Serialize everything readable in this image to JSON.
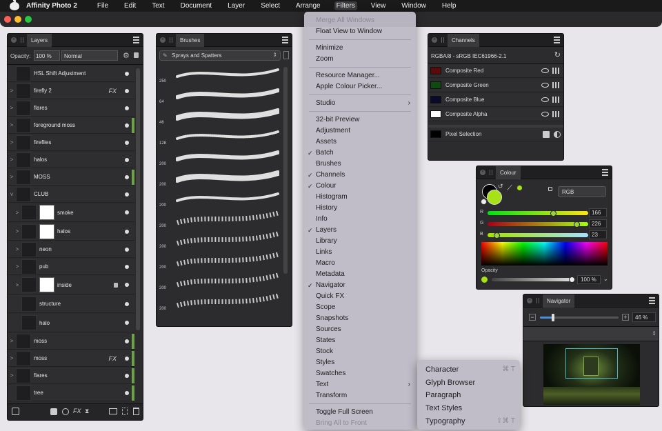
{
  "menubar": {
    "app": "Affinity Photo 2",
    "items": [
      "File",
      "Edit",
      "Text",
      "Document",
      "Layer",
      "Select",
      "Arrange",
      "Filters",
      "View",
      "Window",
      "Help"
    ],
    "open_index": 7
  },
  "layers": {
    "tab": "Layers",
    "opacity_label": "Opacity:",
    "opacity_value": "100 %",
    "blend_mode": "Normal",
    "rows": [
      {
        "name": "HSL Shift Adjustment",
        "exp": "",
        "tag": false,
        "fx": ""
      },
      {
        "name": "firefly 2",
        "exp": ">",
        "tag": false,
        "fx": "FX"
      },
      {
        "name": "flares",
        "exp": ">",
        "tag": false,
        "fx": ""
      },
      {
        "name": "foreground moss",
        "exp": ">",
        "tag": true,
        "fx": ""
      },
      {
        "name": "fireflies",
        "exp": ">",
        "tag": false,
        "fx": ""
      },
      {
        "name": "halos",
        "exp": ">",
        "tag": false,
        "fx": ""
      },
      {
        "name": "MOSS",
        "exp": ">",
        "tag": true,
        "fx": ""
      },
      {
        "name": "CLUB",
        "exp": "v",
        "tag": false,
        "fx": ""
      },
      {
        "name": "smoke",
        "exp": ">",
        "tag": false,
        "fx": ""
      },
      {
        "name": "halos",
        "exp": ">",
        "tag": false,
        "fx": ""
      },
      {
        "name": "neon",
        "exp": ">",
        "tag": false,
        "fx": ""
      },
      {
        "name": "pub",
        "exp": ">",
        "tag": false,
        "fx": ""
      },
      {
        "name": "inside",
        "exp": ">",
        "tag": false,
        "fx": ""
      },
      {
        "name": "structure",
        "exp": "",
        "tag": false,
        "fx": ""
      },
      {
        "name": "halo",
        "exp": "",
        "tag": false,
        "fx": ""
      },
      {
        "name": "moss",
        "exp": ">",
        "tag": true,
        "fx": ""
      },
      {
        "name": "moss",
        "exp": ">",
        "tag": true,
        "fx": "FX"
      },
      {
        "name": "flares",
        "exp": ">",
        "tag": true,
        "fx": ""
      },
      {
        "name": "tree",
        "exp": "",
        "tag": true,
        "fx": ""
      }
    ]
  },
  "brushes": {
    "tab": "Brushes",
    "category": "Sprays and Spatters",
    "sizes": [
      "250",
      "64",
      "46",
      "128",
      "200",
      "200",
      "200",
      "200",
      "200",
      "200",
      "200",
      "200"
    ]
  },
  "filters_menu": {
    "items": [
      {
        "label": "Merge All Windows",
        "disabled": true,
        "check": false,
        "sub": false
      },
      {
        "label": "Float View to Window",
        "disabled": false,
        "check": false,
        "sub": false
      },
      {
        "sep": true
      },
      {
        "label": "Minimize",
        "disabled": false,
        "check": false,
        "sub": false
      },
      {
        "label": "Zoom",
        "disabled": false,
        "check": false,
        "sub": false
      },
      {
        "sep": true
      },
      {
        "label": "Resource Manager...",
        "disabled": false,
        "check": false,
        "sub": false
      },
      {
        "label": "Apple Colour Picker...",
        "disabled": false,
        "check": false,
        "sub": false
      },
      {
        "sep": true
      },
      {
        "label": "Studio",
        "disabled": false,
        "check": false,
        "sub": true
      },
      {
        "sep": true
      },
      {
        "label": "32-bit Preview",
        "disabled": false,
        "check": false,
        "sub": false
      },
      {
        "label": "Adjustment",
        "disabled": false,
        "check": false,
        "sub": false
      },
      {
        "label": "Assets",
        "disabled": false,
        "check": false,
        "sub": false
      },
      {
        "label": "Batch",
        "disabled": false,
        "check": true,
        "sub": false
      },
      {
        "label": "Brushes",
        "disabled": false,
        "check": false,
        "sub": false
      },
      {
        "label": "Channels",
        "disabled": false,
        "check": true,
        "sub": false
      },
      {
        "label": "Colour",
        "disabled": false,
        "check": true,
        "sub": false
      },
      {
        "label": "Histogram",
        "disabled": false,
        "check": false,
        "sub": false
      },
      {
        "label": "History",
        "disabled": false,
        "check": false,
        "sub": false
      },
      {
        "label": "Info",
        "disabled": false,
        "check": false,
        "sub": false
      },
      {
        "label": "Layers",
        "disabled": false,
        "check": true,
        "sub": false
      },
      {
        "label": "Library",
        "disabled": false,
        "check": false,
        "sub": false
      },
      {
        "label": "Links",
        "disabled": false,
        "check": false,
        "sub": false
      },
      {
        "label": "Macro",
        "disabled": false,
        "check": false,
        "sub": false
      },
      {
        "label": "Metadata",
        "disabled": false,
        "check": false,
        "sub": false
      },
      {
        "label": "Navigator",
        "disabled": false,
        "check": true,
        "sub": false
      },
      {
        "label": "Quick FX",
        "disabled": false,
        "check": false,
        "sub": false
      },
      {
        "label": "Scope",
        "disabled": false,
        "check": false,
        "sub": false
      },
      {
        "label": "Snapshots",
        "disabled": false,
        "check": false,
        "sub": false
      },
      {
        "label": "Sources",
        "disabled": false,
        "check": false,
        "sub": false
      },
      {
        "label": "States",
        "disabled": false,
        "check": false,
        "sub": false
      },
      {
        "label": "Stock",
        "disabled": false,
        "check": false,
        "sub": false
      },
      {
        "label": "Styles",
        "disabled": false,
        "check": false,
        "sub": false
      },
      {
        "label": "Swatches",
        "disabled": false,
        "check": false,
        "sub": false
      },
      {
        "label": "Text",
        "disabled": false,
        "check": false,
        "sub": true
      },
      {
        "label": "Transform",
        "disabled": false,
        "check": false,
        "sub": false
      },
      {
        "sep": true
      },
      {
        "label": "Toggle Full Screen",
        "disabled": false,
        "check": false,
        "sub": false
      },
      {
        "label": "Bring All to Front",
        "disabled": true,
        "check": false,
        "sub": false
      }
    ]
  },
  "text_submenu": {
    "items": [
      {
        "label": "Character",
        "shortcut": "⌘ T"
      },
      {
        "label": "Glyph Browser",
        "shortcut": ""
      },
      {
        "label": "Paragraph",
        "shortcut": ""
      },
      {
        "label": "Text Styles",
        "shortcut": ""
      },
      {
        "label": "Typography",
        "shortcut": "⇧⌘ T"
      }
    ]
  },
  "channels": {
    "tab": "Channels",
    "profile": "RGBA/8 - sRGB IEC61966-2.1",
    "rows": [
      {
        "name": "Composite Red",
        "swatch": "#5a0a0a"
      },
      {
        "name": "Composite Green",
        "swatch": "#0f4a10"
      },
      {
        "name": "Composite Blue",
        "swatch": "#0a0a2a"
      },
      {
        "name": "Composite Alpha",
        "swatch": "#ffffff"
      }
    ],
    "pixel_selection": "Pixel Selection"
  },
  "colour": {
    "tab": "Colour",
    "mode": "RGB",
    "r_label": "R",
    "g_label": "G",
    "b_label": "B",
    "r": "166",
    "g": "226",
    "b": "23",
    "r_frac": 0.651,
    "g_frac": 0.886,
    "b_frac": 0.09,
    "opacity_label": "Opacity",
    "opacity_value": "100 %",
    "opacity_frac": 1.0,
    "accent": "#a6e217"
  },
  "navigator": {
    "tab": "Navigator",
    "zoom": "46 %"
  }
}
